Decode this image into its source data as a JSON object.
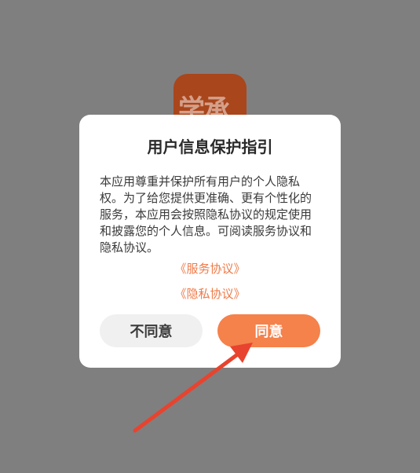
{
  "app_icon": {
    "text": "学承",
    "background": "#a9461c"
  },
  "dialog": {
    "title": "用户信息保护指引",
    "body": "本应用尊重并保护所有用户的个人隐私权。为了给您提供更准确、更有个性化的服务，本应用会按照隐私协议的规定使用和披露您的个人信息。可阅读服务协议和隐私协议。",
    "service_link": "《服务协议》",
    "privacy_link": "《隐私协议》",
    "disagree_label": "不同意",
    "agree_label": "同意"
  },
  "colors": {
    "overlay": "#7f7f7f",
    "link": "#f07a48",
    "agree_button": "#f5814b",
    "disagree_button": "#f0f0f0",
    "annotation_arrow": "#e8432e"
  }
}
